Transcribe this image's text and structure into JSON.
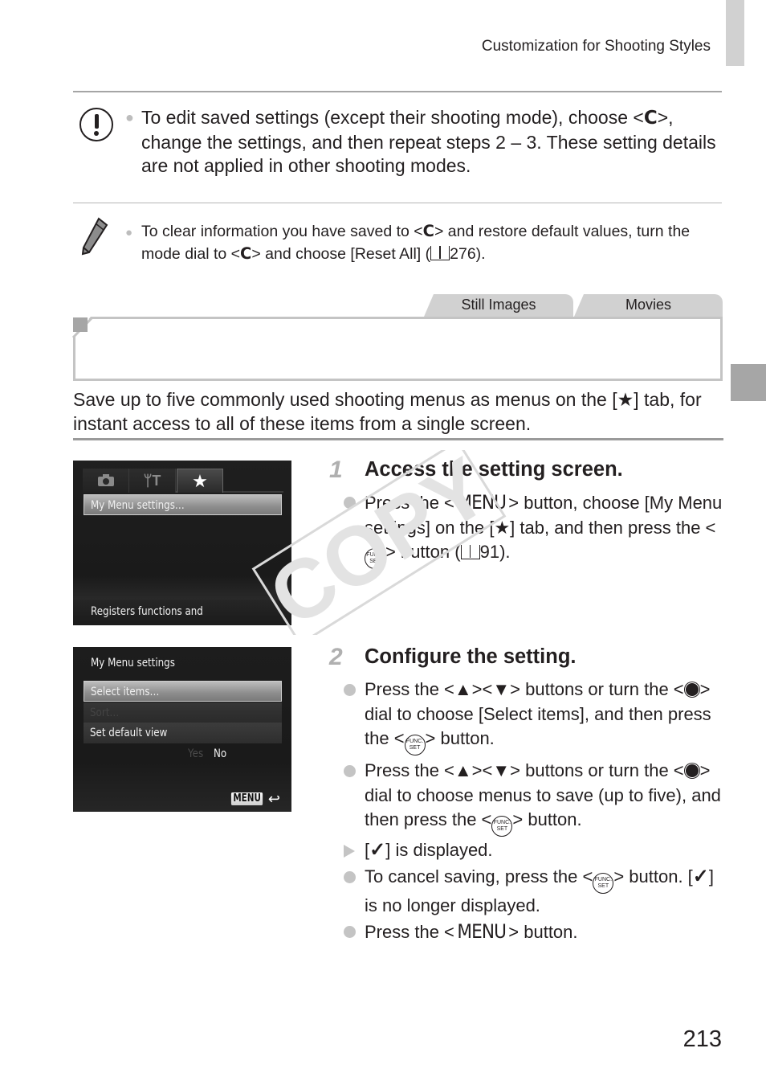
{
  "header": {
    "running_head": "Customization for Shooting Styles"
  },
  "caution": {
    "icon": "caution-exclamation-icon",
    "text_before_c": "To edit saved settings (except their shooting mode), choose <",
    "c_glyph": "C",
    "text_after_c": ">, change the settings, and then repeat steps 2 – 3. These setting details are not applied in other shooting modes."
  },
  "memo": {
    "icon": "pencil-icon",
    "part1": "To clear information you have saved to <",
    "c_glyph": "C",
    "part2": "> and restore default values, turn the mode dial to <",
    "part3": "> and choose [Reset All] (",
    "book_icon": "book-reference-icon",
    "page_ref": "276",
    "part4": ")."
  },
  "availability_tabs": [
    "Still Images",
    "Movies"
  ],
  "section": {
    "heading": "",
    "intro_part1": "Save up to five commonly used shooting menus as menus on the [",
    "star_glyph": "★",
    "intro_part2": "] tab, for instant access to all of these items from a single screen."
  },
  "screen1": {
    "tabs": [
      "camera-icon",
      "tools-icon",
      "star-icon"
    ],
    "tab_glyphs": [
      "◙",
      "ᛘT",
      "★"
    ],
    "selected_item": "My Menu settings…",
    "help_text": "Registers functions and"
  },
  "screen2": {
    "title": "My Menu settings",
    "items": [
      {
        "label": "Select items…",
        "state": "selected"
      },
      {
        "label": "Sort…",
        "state": "disabled"
      },
      {
        "label": "Set default view",
        "options": [
          "Yes",
          "No"
        ],
        "current": "No"
      }
    ],
    "back_badge": "MENU",
    "back_icon": "↩"
  },
  "steps": [
    {
      "number": "1",
      "title": "Access the setting screen.",
      "items": [
        {
          "marker": "bullet",
          "p1": "Press the <",
          "menu": "MENU",
          "p2": "> button, choose [My Menu settings] on the [",
          "star": "★",
          "p3": "] tab, and then press the <",
          "func_top": "FUNC.",
          "func_bottom": "SET",
          "p4": "> button (",
          "page_ref": "91",
          "p5": ")."
        }
      ]
    },
    {
      "number": "2",
      "title": "Configure the setting.",
      "items": [
        {
          "marker": "bullet",
          "p1": "Press the <",
          "up": "▲",
          "p2": "><",
          "down": "▼",
          "p3": "> buttons or turn the <",
          "p4": "> dial to choose [Select items], and then press the <",
          "func_top": "FUNC.",
          "func_bottom": "SET",
          "p5": "> button."
        },
        {
          "marker": "bullet",
          "p1": "Press the <",
          "up": "▲",
          "p2": "><",
          "down": "▼",
          "p3": "> buttons or turn the <",
          "p4": "> dial to choose menus to save (up to five), and then press the <",
          "func_top": "FUNC.",
          "func_bottom": "SET",
          "p5": "> button."
        },
        {
          "marker": "result",
          "p1": "[",
          "check": "✓",
          "p2": "] is displayed."
        },
        {
          "marker": "bullet",
          "p1": "To cancel saving, press the <",
          "func_top": "FUNC.",
          "func_bottom": "SET",
          "p2": "> button. [",
          "check": "✓",
          "p3": "] is no longer displayed."
        },
        {
          "marker": "bullet",
          "p1": "Press the <",
          "menu": "MENU",
          "p2": "> button."
        }
      ]
    }
  ],
  "watermark": "COPY",
  "page_number": "213"
}
